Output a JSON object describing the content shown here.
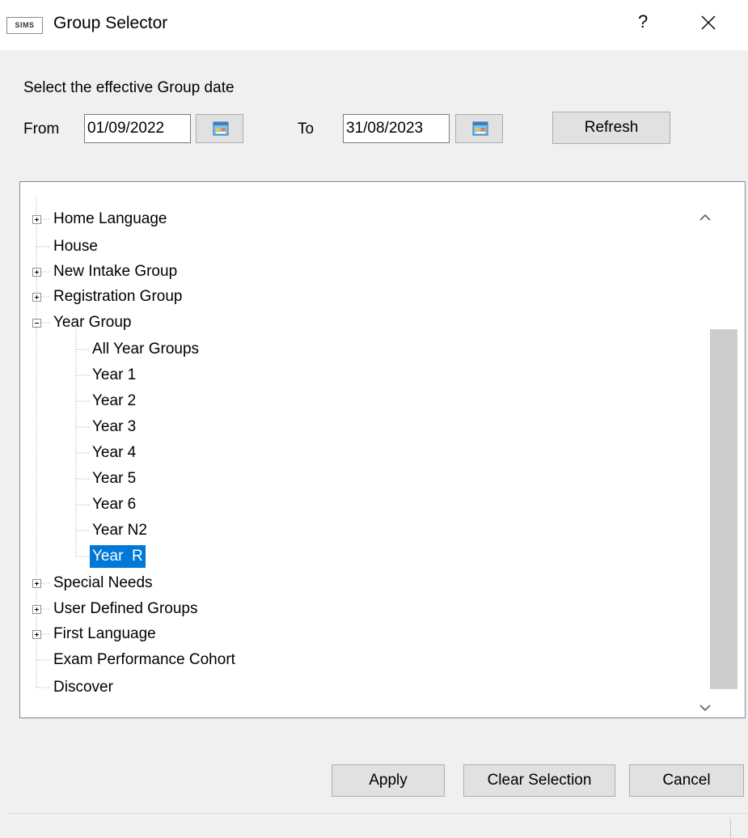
{
  "window": {
    "app_icon_text": "SIMS",
    "title": "Group Selector",
    "help_label": "?",
    "close_icon": "close-icon"
  },
  "date_range": {
    "heading": "Select the effective Group date",
    "from_label": "From",
    "from_value": "01/09/2022",
    "to_label": "To",
    "to_value": "31/08/2023",
    "calendar_icon": "calendar-icon",
    "refresh_label": "Refresh"
  },
  "tree": {
    "items": [
      {
        "label": "Home Language",
        "expander": "plus"
      },
      {
        "label": "House",
        "expander": "none"
      },
      {
        "label": "New Intake Group",
        "expander": "plus"
      },
      {
        "label": "Registration Group",
        "expander": "plus"
      },
      {
        "label": "Year Group",
        "expander": "minus"
      },
      {
        "label": "All Year Groups",
        "child": true
      },
      {
        "label": "Year  1",
        "child": true
      },
      {
        "label": "Year  2",
        "child": true
      },
      {
        "label": "Year  3",
        "child": true
      },
      {
        "label": "Year  4",
        "child": true
      },
      {
        "label": "Year  5",
        "child": true
      },
      {
        "label": "Year  6",
        "child": true
      },
      {
        "label": "Year  N2",
        "child": true
      },
      {
        "label": "Year  R",
        "child": true,
        "selected": true
      },
      {
        "label": "Special Needs",
        "expander": "plus"
      },
      {
        "label": "User Defined Groups",
        "expander": "plus"
      },
      {
        "label": "First Language",
        "expander": "plus"
      },
      {
        "label": "Exam Performance Cohort",
        "expander": "none"
      },
      {
        "label": "Discover",
        "expander": "none"
      }
    ],
    "scroll_up_icon": "chevron-up-icon",
    "scroll_down_icon": "chevron-down-icon"
  },
  "footer": {
    "apply_label": "Apply",
    "clear_label": "Clear Selection",
    "cancel_label": "Cancel"
  },
  "colors": {
    "selection": "#0078d7",
    "button_face": "#e1e1e1",
    "dialog_bg": "#f0f0f0"
  }
}
